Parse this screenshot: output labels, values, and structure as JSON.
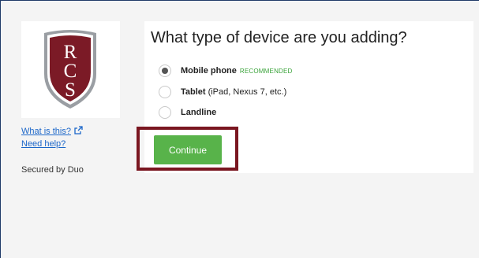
{
  "sidebar": {
    "logo_text": "RCS",
    "what_is_this": "What is this?",
    "need_help": "Need help?",
    "secured_by": "Secured by Duo"
  },
  "main": {
    "title": "What type of device are you adding?",
    "options": [
      {
        "name": "Mobile phone",
        "detail": "",
        "badge": "RECOMMENDED",
        "selected": true
      },
      {
        "name": "Tablet",
        "detail": "(iPad, Nexus 7, etc.)",
        "badge": "",
        "selected": false
      },
      {
        "name": "Landline",
        "detail": "",
        "badge": "",
        "selected": false
      }
    ],
    "continue_label": "Continue"
  },
  "colors": {
    "accent_green": "#58b34a",
    "recommended_green": "#38a238",
    "highlight_maroon": "#7a1620",
    "shield_maroon": "#7b1a26",
    "link_blue": "#1b66c9"
  },
  "icons": [
    "rcs-shield-logo-icon",
    "external-link-icon",
    "radio-checked-icon",
    "radio-unchecked-icon"
  ]
}
